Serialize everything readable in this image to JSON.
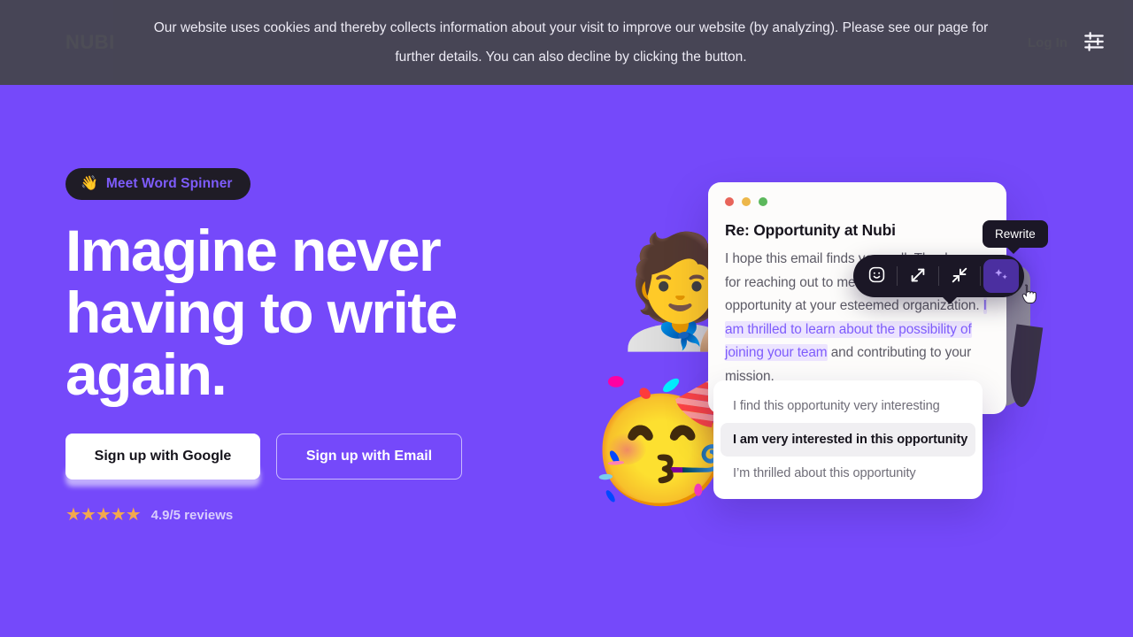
{
  "header": {
    "logo": "NUBI",
    "login_label": "Log In"
  },
  "cookie_banner": {
    "message": "Our website uses cookies and thereby collects information about your visit to improve our website (by analyzing). Please see our page for further details. You can also decline by clicking the button.",
    "settings_icon": "sliders-settings-icon",
    "background_color": "#45454e"
  },
  "hero": {
    "badge": {
      "emoji": "👋",
      "label": "Meet Word Spinner"
    },
    "title": "Imagine never having to write again.",
    "cta_google": "Sign up with Google",
    "cta_email": "Sign up with Email",
    "rating": {
      "stars": "★★★★★",
      "text": "4.9/5 reviews",
      "star_color": "#f3a94d"
    },
    "background_color": "#7549fa"
  },
  "decorations": {
    "memoji_top": "🧑‍🎨",
    "memoji_bottom": "🥳"
  },
  "email_card": {
    "window_dots": [
      "red",
      "yellow",
      "green"
    ],
    "subject": "Re: Opportunity at Nubi",
    "body_before": "I hope this email finds you well. Thank you for reaching out to me regarding the opportunity at your esteemed organization. ",
    "body_highlight": "I am thrilled to learn about the possibility of joining your team",
    "body_after": " and contributing to your mission.",
    "highlight_color": "#7e5cfc"
  },
  "toolbar": {
    "tooltip": "Rewrite",
    "buttons": [
      {
        "name": "emoji-tone-icon",
        "label": "Tone"
      },
      {
        "name": "expand-arrows-icon",
        "label": "Make longer"
      },
      {
        "name": "shrink-arrows-icon",
        "label": "Make shorter"
      },
      {
        "name": "sparkles-icon",
        "label": "Rewrite"
      }
    ],
    "active_index": 3,
    "active_color": "#4b2fa0"
  },
  "suggestions": {
    "items": [
      "I find this opportunity very interesting",
      "I am very interested in this opportunity",
      "I’m thrilled about this opportunity"
    ],
    "selected_index": 1
  }
}
